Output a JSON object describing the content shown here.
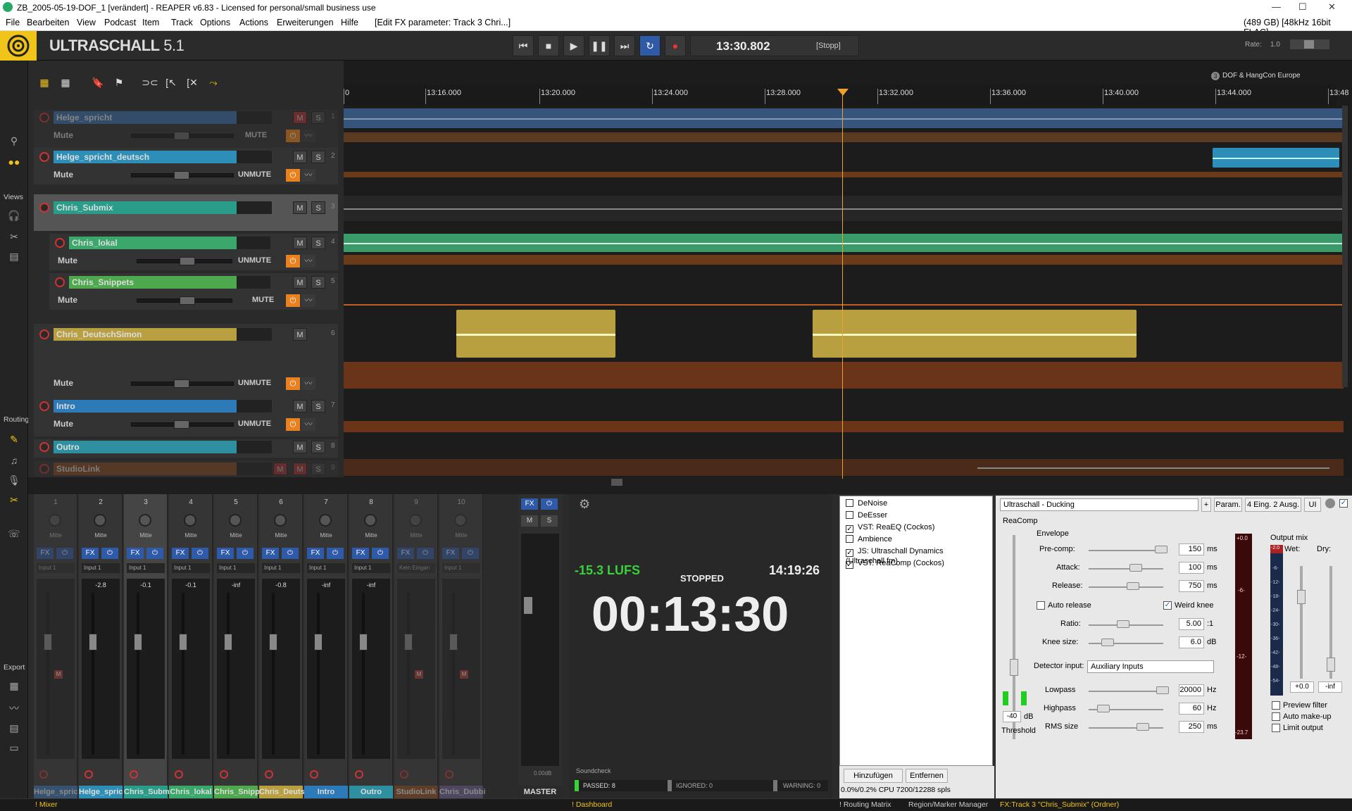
{
  "window": {
    "title": "ZB_2005-05-19-DOF_1 [verändert] - REAPER v6.83 - Licensed for personal/small business use"
  },
  "menu": {
    "items": [
      "File",
      "Bearbeiten",
      "View",
      "Podcast",
      "Item",
      "Track",
      "Options",
      "Actions",
      "Erweiterungen",
      "Hilfe",
      "[Edit FX parameter: Track 3 Chri...]"
    ],
    "right_info": "(489 GB) [48kHz 16bit FLAC]"
  },
  "header": {
    "app_name": "ULTRASCHALL",
    "version": "5.1",
    "time": "13:30.802",
    "state": "[Stopp]",
    "rate_label": "Rate:",
    "rate_value": "1.0"
  },
  "sidebar": {
    "views": "Views",
    "routing": "Routing",
    "export": "Export"
  },
  "ruler": {
    "marker": "DOF & HangCon Europe",
    "marker_num": "3",
    "ticks": [
      "0",
      "13:16.000",
      "13:20.000",
      "13:24.000",
      "13:28.000",
      "13:32.000",
      "13:36.000",
      "13:40.000",
      "13:44.000",
      "13:48"
    ]
  },
  "tracks": [
    {
      "name": "Helge_spricht",
      "num": "1",
      "lane_label": "Mute",
      "lane_state": "MUTE",
      "color": "#3a6fa8"
    },
    {
      "name": "Helge_spricht_deutsch",
      "num": "2",
      "lane_label": "Mute",
      "lane_state": "UNMUTE",
      "color": "#2d8fb8"
    },
    {
      "name": "Chris_Submix",
      "num": "3",
      "color": "#2a9c8a"
    },
    {
      "name": "Chris_lokal",
      "num": "4",
      "lane_label": "Mute",
      "lane_state": "UNMUTE",
      "color": "#3aa86a"
    },
    {
      "name": "Chris_Snippets",
      "num": "5",
      "lane_label": "Mute",
      "lane_state": "MUTE",
      "color": "#4ea84e"
    },
    {
      "name": "Chris_DeutschSimon",
      "num": "6",
      "lane_label": "Mute",
      "lane_state": "UNMUTE",
      "color": "#b8a040"
    },
    {
      "name": "Intro",
      "num": "7",
      "lane_label": "Mute",
      "lane_state": "UNMUTE",
      "color": "#2d7ab8"
    },
    {
      "name": "Outro",
      "num": "8",
      "color": "#2d8fa0"
    },
    {
      "name": "StudioLink",
      "num": "9",
      "color": "#8a4a20"
    }
  ],
  "buttons": {
    "m": "M",
    "s": "S"
  },
  "mixer": {
    "strips": [
      {
        "num": "1",
        "vol": "",
        "pan": "Mitte",
        "input": "Input 1",
        "label": "Helge_spric",
        "dim": true
      },
      {
        "num": "2",
        "vol": "-2.8",
        "pan": "Mitte",
        "input": "Input 1",
        "label": "Helge_spric",
        "dim": false
      },
      {
        "num": "3",
        "vol": "-0.1",
        "pan": "Mitte",
        "input": "Input 1",
        "label": "Chris_Subm",
        "dim": false
      },
      {
        "num": "4",
        "vol": "-0.1",
        "pan": "Mitte",
        "input": "Input 1",
        "label": "Chris_lokal",
        "dim": false
      },
      {
        "num": "5",
        "vol": "-inf",
        "pan": "Mitte",
        "input": "Input 1",
        "label": "Chris_Snipp",
        "dim": false
      },
      {
        "num": "6",
        "vol": "-0.8",
        "pan": "Mitte",
        "input": "Input 1",
        "label": "Chris_Deuts",
        "dim": false
      },
      {
        "num": "7",
        "vol": "-inf",
        "pan": "Mitte",
        "input": "Input 1",
        "label": "Intro",
        "dim": false
      },
      {
        "num": "8",
        "vol": "-inf",
        "pan": "Mitte",
        "input": "Input 1",
        "label": "Outro",
        "dim": false
      },
      {
        "num": "9",
        "vol": "",
        "pan": "Mitte",
        "input": "Kein Eingan",
        "label": "StudioLink",
        "dim": true
      },
      {
        "num": "10",
        "vol": "",
        "pan": "Mitte",
        "input": "Input 1",
        "label": "Chris_Dubbi",
        "dim": true
      }
    ],
    "fx": "FX",
    "master": "MASTER",
    "master_db": "0.00dB",
    "scale": [
      "-0-",
      "-6-",
      "-12-",
      "-18-",
      "-24-",
      "-30-",
      "-36-",
      "-42-",
      "-48-",
      "-54-"
    ]
  },
  "dashboard": {
    "lufs": "-15.3 LUFS",
    "state": "STOPPED",
    "clock": "14:19:26",
    "time": "00:13:30",
    "soundcheck": "Soundcheck",
    "passed": "PASSED: 8",
    "ignored": "IGNORED: 0",
    "warning": "WARNING: 0"
  },
  "fxchain": {
    "items": [
      {
        "label": "DeNoise",
        "checked": ""
      },
      {
        "label": "DeEsser",
        "checked": ""
      },
      {
        "label": "VST: ReaEQ (Cockos)",
        "checked": "✓"
      },
      {
        "label": "Ambience",
        "checked": ""
      },
      {
        "label": "JS: Ultraschall Dynamics (Ultraschall.fm)",
        "checked": "✓"
      },
      {
        "label": "VST: ReaComp (Cockos)",
        "checked": "✓"
      }
    ],
    "add": "Hinzufügen",
    "remove": "Entfernen",
    "cpu": "0.0%/0.2% CPU 7200/12288 spls"
  },
  "plugin": {
    "preset": "Ultraschall - Ducking",
    "plus": "+",
    "param": "Param.",
    "io": "4 Eing. 2 Ausg.",
    "ui": "UI",
    "group": "ReaComp",
    "envelope": "Envelope",
    "precomp_label": "Pre-comp:",
    "precomp": "150",
    "attack_label": "Attack:",
    "attack": "100",
    "release_label": "Release:",
    "release": "750",
    "ms": "ms",
    "auto_release": "Auto release",
    "weird_knee": "Weird knee",
    "ratio_label": "Ratio:",
    "ratio": "5.00",
    "ratio_unit": ":1",
    "knee_label": "Knee size:",
    "knee": "6.0",
    "db": "dB",
    "detector_label": "Detector input:",
    "detector": "Auxiliary Inputs",
    "lowpass_label": "Lowpass",
    "lowpass": "20000",
    "highpass_label": "Highpass",
    "highpass": "60",
    "hz": "Hz",
    "rms_label": "RMS size",
    "rms": "250",
    "threshold_val": "-40",
    "threshold_label": "Threshold",
    "meter_top": "+0.0",
    "meter_vals": [
      "-6-",
      "-12-"
    ],
    "meter_bottom": "-23.7",
    "output_mix": "Output mix",
    "wet": "Wet:",
    "dry": "Dry:",
    "out_top": "-2.0",
    "out_scale": [
      "-6-",
      "-12-",
      "-18-",
      "-24-",
      "-30-",
      "-36-",
      "-42-",
      "-48-",
      "-54-"
    ],
    "wet_val": "+0.0",
    "dry_val": "-inf",
    "preview": "Preview filter",
    "automakeup": "Auto make-up",
    "limit": "Limit output"
  },
  "status": {
    "mixer": "Mixer",
    "dashboard": "Dashboard",
    "routing": "Routing Matrix",
    "region": "Region/Marker Manager",
    "fxtrack": "FX:Track 3 \"Chris_Submix\" (Ordner)"
  }
}
